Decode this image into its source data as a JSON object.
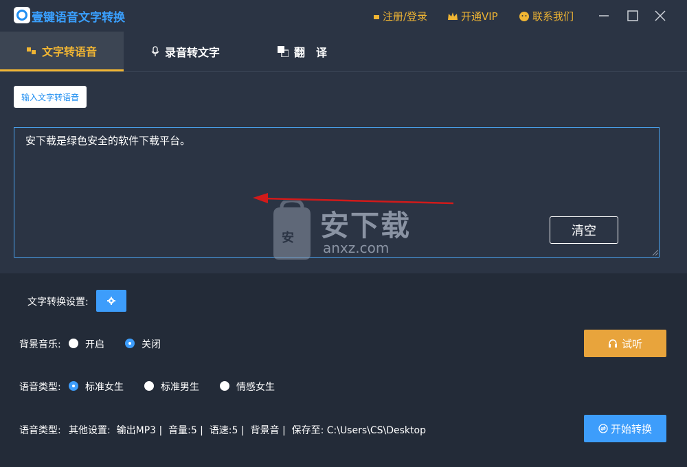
{
  "app": {
    "title": "壹键语音文字转换"
  },
  "topbar": {
    "register_login": "注册/登录",
    "vip": "开通VIP",
    "contact": "联系我们"
  },
  "tabs": [
    {
      "label": "文字转语音",
      "active": true,
      "icon": "text-to-speech-icon"
    },
    {
      "label": "录音转文字",
      "active": false,
      "icon": "microphone-icon"
    },
    {
      "label": "翻　译",
      "active": false,
      "icon": "translate-icon"
    }
  ],
  "editor": {
    "mode_button": "输入文字转语音",
    "text": "安下载是绿色安全的软件下载平台。",
    "clear_label": "清空"
  },
  "watermark": {
    "main": "安下载",
    "sub": "anxz.com",
    "badge": "安"
  },
  "settings": {
    "conversion_settings_label": "文字转换设置:",
    "bg_music": {
      "label": "背景音乐:",
      "options": [
        "开启",
        "关闭"
      ],
      "selected": "关闭"
    },
    "voice_type": {
      "label": "语音类型:",
      "options": [
        "标准女生",
        "标准男生",
        "情感女生"
      ],
      "selected": "标准女生"
    },
    "summary_label": "语音类型:",
    "summary_text": "其他设置:  输出MP3 |  音量:5 |  语速:5 |  背景音 |  保存至: C:\\Users\\CS\\Desktop",
    "listen_label": "试听",
    "start_label": "开始转换"
  },
  "colors": {
    "accent": "#3d9dfb",
    "gold": "#f0b533",
    "listen": "#e8a43c",
    "bg": "#2b3444"
  }
}
